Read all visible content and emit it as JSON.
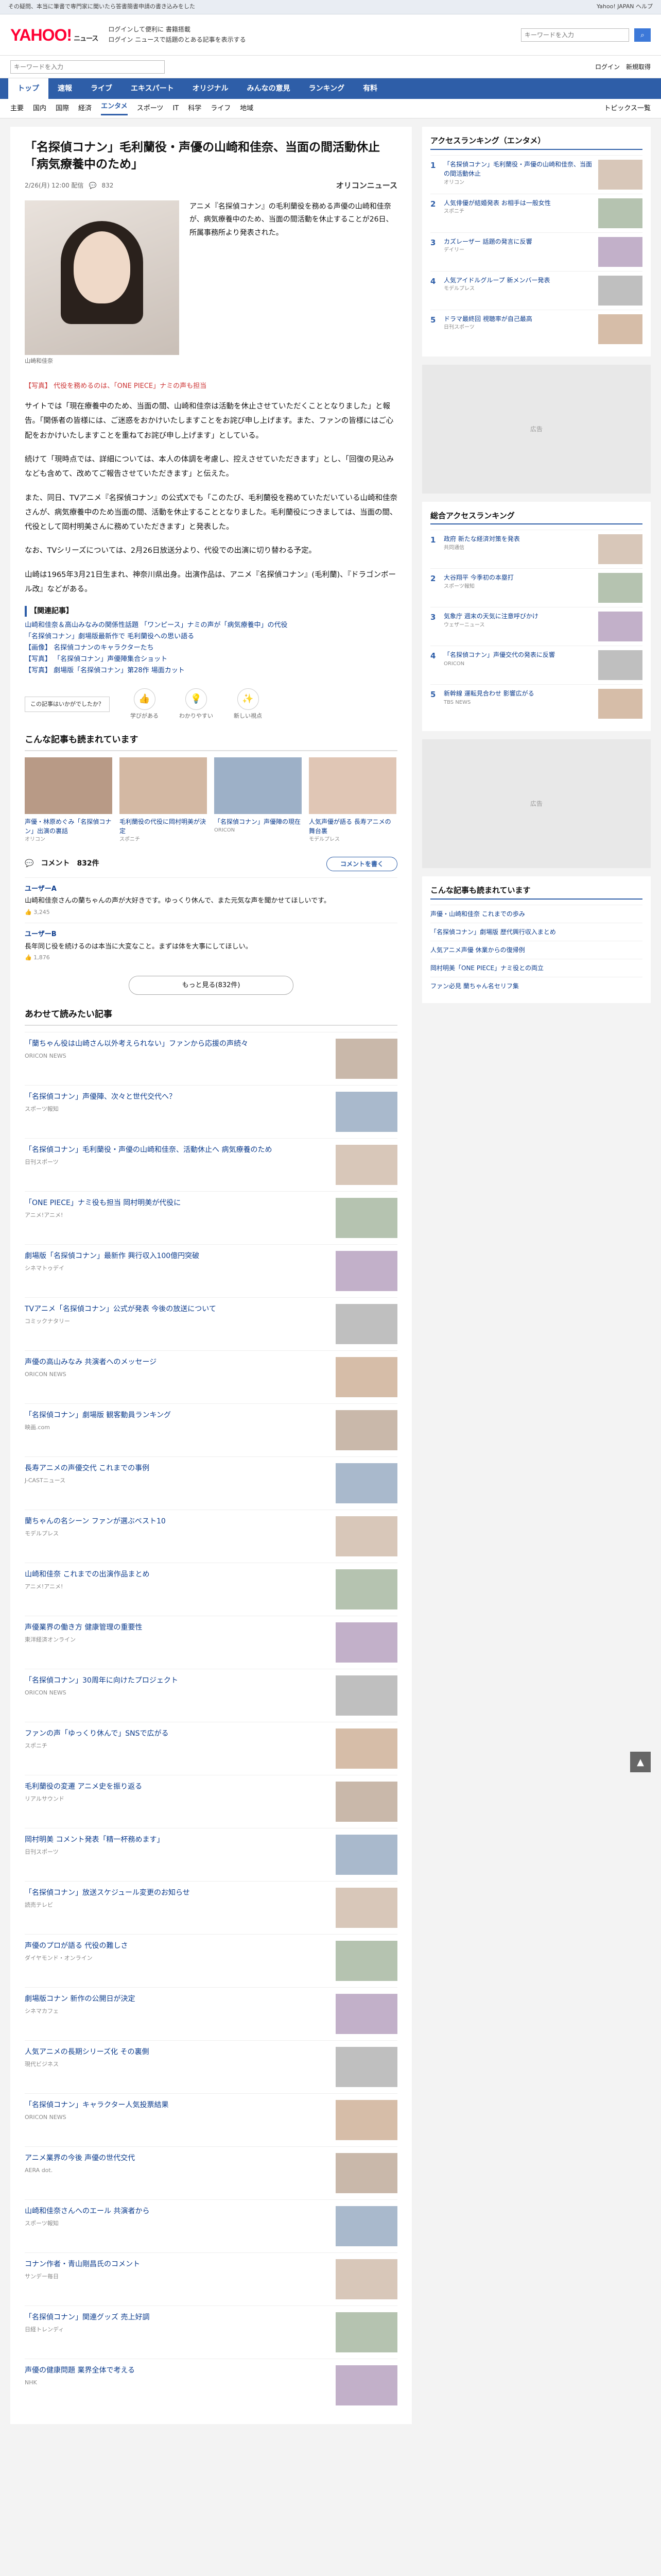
{
  "topbar": {
    "text": "その疑問、本当に筆書で専門家に聞いたら答書簡書申請の書き込みをした",
    "right": "Yahoo! JAPAN  ヘルプ"
  },
  "header": {
    "logo": "YAHOO!",
    "logo_sub": "ニュース",
    "links1": "ログインして便利に 書籍搭載",
    "links2": "ログイン ニュースで話題のとある記事を表示する",
    "search_placeholder": "キーワードを入力",
    "search_label": "検索",
    "login": "ログイン",
    "register": "新規取得"
  },
  "subhead": {
    "placeholder": "キーワードを入力",
    "menu": "メニュー"
  },
  "nav": [
    "トップ",
    "速報",
    "ライブ",
    "エキスパート",
    "オリジナル",
    "みんなの意見",
    "ランキング",
    "有料"
  ],
  "nav_active": 0,
  "subnav": [
    "主要",
    "国内",
    "国際",
    "経済",
    "エンタメ",
    "スポーツ",
    "IT",
    "科学",
    "ライフ",
    "地域"
  ],
  "subnav_active": 4,
  "subnav_right": "トピックス一覧",
  "article": {
    "title": "「名探偵コナン」毛利蘭役・声優の山崎和佳奈、当面の間活動休止「病気療養中のため」",
    "date": "2/26(月) 12:00 配信",
    "comments_count": "832",
    "provider": "オリコンニュース",
    "photo_caption": "山崎和佳奈",
    "lead": "アニメ『名探偵コナン』の毛利蘭役を務める声優の山崎和佳奈が、病気療養中のため、当面の間活動を休止することが26日、所属事務所より発表された。",
    "photo_link": "【写真】 代役を務めるのは、「ONE PIECE」ナミの声も担当",
    "paragraphs": [
      "サイトでは「現在療養中のため、当面の間、山崎和佳奈は活動を休止させていただくこととなりました」と報告。「関係者の皆様には、ご迷惑をおかけいたしますことをお詫び申し上げます。また、ファンの皆様にはご心配をおかけいたしますことを重ねてお詫び申し上げます」としている。",
      "続けて「現時点では、詳細については、本人の体調を考慮し、控えさせていただきます」とし、「回復の見込みなども含めて、改めてご報告させていただきます」と伝えた。",
      "また、同日、TVアニメ『名探偵コナン』の公式Xでも「このたび、毛利蘭役を務めていただいている山崎和佳奈さんが、病気療養中のため当面の間、活動を休止することとなりました。毛利蘭役につきましては、当面の間、代役として岡村明美さんに務めていただきます」と発表した。",
      "なお、TVシリーズについては、2月26日放送分より、代役での出演に切り替わる予定。",
      "山崎は1965年3月21日生まれ、神奈川県出身。出演作品は、アニメ『名探偵コナン』(毛利蘭)、『ドラゴンボール改』などがある。"
    ]
  },
  "related": {
    "title": "【関連記事】",
    "items": [
      "山崎和佳奈＆高山みなみの関係性話題 「ワンピース」ナミの声が「病気療養中」の代役",
      "「名探偵コナン」劇場版最新作で 毛利蘭役への思い語る",
      "【画像】 名探偵コナンのキャラクターたち",
      "【写真】 「名探偵コナン」声優陣集合ショット",
      "【写真】 劇場版「名探偵コナン」第28作 場面カット"
    ]
  },
  "reactions": {
    "prompt": "この記事はいかがでしたか？",
    "buttons": [
      {
        "icon": "👍",
        "label": "学びがある"
      },
      {
        "icon": "💡",
        "label": "わかりやすい"
      },
      {
        "icon": "✨",
        "label": "新しい視点"
      }
    ]
  },
  "recommend": {
    "title": "こんな記事も読まれています",
    "cards": [
      {
        "title": "声優・林原めぐみ「名探偵コナン」出演の裏話",
        "src": "オリコン"
      },
      {
        "title": "毛利蘭役の代役に岡村明美が決定",
        "src": "スポニチ"
      },
      {
        "title": "「名探偵コナン」声優陣の現在",
        "src": "ORICON"
      },
      {
        "title": "人気声優が語る 長寿アニメの舞台裏",
        "src": "モデルプレス"
      }
    ]
  },
  "comments": {
    "heading": "コメント",
    "count": "832件",
    "post_button": "コメントを書く",
    "items": [
      {
        "user": "ユーザーA",
        "text": "山崎和佳奈さんの蘭ちゃんの声が大好きです。ゆっくり休んで、また元気な声を聞かせてほしいです。",
        "likes": "3,245"
      },
      {
        "user": "ユーザーB",
        "text": "長年同じ役を続けるのは本当に大変なこと。まずは体を大事にしてほしい。",
        "likes": "1,876"
      }
    ],
    "more": "もっと見る(832件)"
  },
  "more_articles": {
    "title": "あわせて読みたい記事",
    "items": [
      {
        "title": "「蘭ちゃん役は山崎さん以外考えられない」ファンから応援の声続々",
        "src": "ORICON NEWS"
      },
      {
        "title": "「名探偵コナン」声優陣、次々と世代交代へ？",
        "src": "スポーツ報知"
      },
      {
        "title": "「名探偵コナン」毛利蘭役・声優の山崎和佳奈、活動休止へ 病気療養のため",
        "src": "日刊スポーツ"
      },
      {
        "title": "「ONE PIECE」ナミ役も担当 岡村明美が代役に",
        "src": "アニメ!アニメ!"
      },
      {
        "title": "劇場版「名探偵コナン」最新作 興行収入100億円突破",
        "src": "シネマトゥデイ"
      },
      {
        "title": "TVアニメ「名探偵コナン」公式が発表 今後の放送について",
        "src": "コミックナタリー"
      },
      {
        "title": "声優の高山みなみ 共演者へのメッセージ",
        "src": "ORICON NEWS"
      },
      {
        "title": "「名探偵コナン」劇場版 観客動員ランキング",
        "src": "映画.com"
      },
      {
        "title": "長寿アニメの声優交代 これまでの事例",
        "src": "J-CASTニュース"
      },
      {
        "title": "蘭ちゃんの名シーン ファンが選ぶベスト10",
        "src": "モデルプレス"
      },
      {
        "title": "山崎和佳奈 これまでの出演作品まとめ",
        "src": "アニメ!アニメ!"
      },
      {
        "title": "声優業界の働き方 健康管理の重要性",
        "src": "東洋経済オンライン"
      },
      {
        "title": "「名探偵コナン」30周年に向けたプロジェクト",
        "src": "ORICON NEWS"
      },
      {
        "title": "ファンの声「ゆっくり休んで」SNSで広がる",
        "src": "スポニチ"
      },
      {
        "title": "毛利蘭役の変遷 アニメ史を振り返る",
        "src": "リアルサウンド"
      },
      {
        "title": "岡村明美 コメント発表「精一杯務めます」",
        "src": "日刊スポーツ"
      },
      {
        "title": "「名探偵コナン」放送スケジュール変更のお知らせ",
        "src": "読売テレビ"
      },
      {
        "title": "声優のプロが語る 代役の難しさ",
        "src": "ダイヤモンド・オンライン"
      },
      {
        "title": "劇場版コナン 新作の公開日が決定",
        "src": "シネマカフェ"
      },
      {
        "title": "人気アニメの長期シリーズ化 その裏側",
        "src": "現代ビジネス"
      },
      {
        "title": "「名探偵コナン」キャラクター人気投票結果",
        "src": "ORICON NEWS"
      },
      {
        "title": "アニメ業界の今後 声優の世代交代",
        "src": "AERA dot."
      },
      {
        "title": "山崎和佳奈さんへのエール 共演者から",
        "src": "スポーツ報知"
      },
      {
        "title": "コナン作者・青山剛昌氏のコメント",
        "src": "サンデー毎日"
      },
      {
        "title": "「名探偵コナン」関連グッズ 売上好調",
        "src": "日経トレンディ"
      },
      {
        "title": "声優の健康問題 業界全体で考える",
        "src": "NHK"
      }
    ]
  },
  "sidebar": {
    "ranking_title": "アクセスランキング（エンタメ）",
    "ranking": [
      {
        "title": "「名探偵コナン」毛利蘭役・声優の山崎和佳奈、当面の間活動休止",
        "src": "オリコン"
      },
      {
        "title": "人気俳優が結婚発表 お相手は一般女性",
        "src": "スポニチ"
      },
      {
        "title": "カズレーザー 話題の発言に反響",
        "src": "デイリー"
      },
      {
        "title": "人気アイドルグループ 新メンバー発表",
        "src": "モデルプレス"
      },
      {
        "title": "ドラマ最終回 視聴率が自己最高",
        "src": "日刊スポーツ"
      }
    ],
    "ad_text": "広告",
    "ranking2_title": "総合アクセスランキング",
    "ranking2": [
      {
        "title": "政府 新たな経済対策を発表",
        "src": "共同通信"
      },
      {
        "title": "大谷翔平 今季初の本塁打",
        "src": "スポーツ報知"
      },
      {
        "title": "気象庁 週末の天気に注意呼びかけ",
        "src": "ウェザーニュース"
      },
      {
        "title": "「名探偵コナン」声優交代の発表に反響",
        "src": "ORICON"
      },
      {
        "title": "新幹線 運転見合わせ 影響広がる",
        "src": "TBS NEWS"
      }
    ],
    "topics_title": "こんな記事も読まれています",
    "topics": [
      "声優・山崎和佳奈 これまでの歩み",
      "「名探偵コナン」劇場版 歴代興行収入まとめ",
      "人気アニメ声優 休業からの復帰例",
      "岡村明美「ONE PIECE」ナミ役との両立",
      "ファン必見 蘭ちゃん名セリフ集"
    ]
  }
}
